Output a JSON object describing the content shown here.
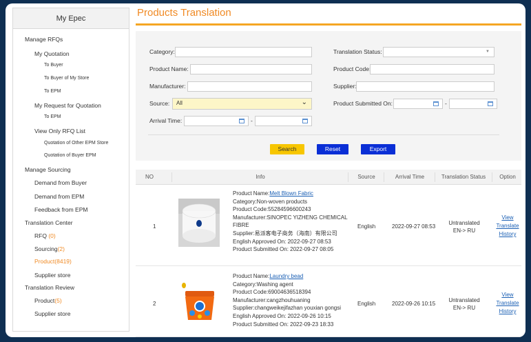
{
  "sidebar": {
    "title": "My Epec",
    "items": [
      {
        "label": "Manage RFQs",
        "level": 0,
        "count": ""
      },
      {
        "label": "My Quotation",
        "level": 1,
        "count": ""
      },
      {
        "label": "To Buyer",
        "level": 2,
        "count": ""
      },
      {
        "label": "To Buyer of My Store",
        "level": 2,
        "count": ""
      },
      {
        "label": "To EPM",
        "level": 2,
        "count": ""
      },
      {
        "label": "My Request for Quotation",
        "level": 1,
        "count": ""
      },
      {
        "label": "To EPM",
        "level": 2,
        "count": ""
      },
      {
        "label": "View Only RFQ List",
        "level": 1,
        "count": ""
      },
      {
        "label": "Quotation of Other EPM Store",
        "level": 2,
        "count": ""
      },
      {
        "label": "Quotation of Buyer EPM",
        "level": 2,
        "count": ""
      },
      {
        "label": "Manage Sourcing",
        "level": 0,
        "count": ""
      },
      {
        "label": "Demand from Buyer",
        "level": 1,
        "count": ""
      },
      {
        "label": "Demand from EPM",
        "level": 1,
        "count": ""
      },
      {
        "label": "Feedback from EPM",
        "level": 1,
        "count": ""
      },
      {
        "label": "Translation Center",
        "level": 0,
        "count": ""
      },
      {
        "label": "RFQ ",
        "level": 1,
        "count": "(0)"
      },
      {
        "label": "Sourcing",
        "level": 1,
        "count": "(2)"
      },
      {
        "label": "Product(8419)",
        "level": 1,
        "count": "",
        "active": true
      },
      {
        "label": "Supplier store",
        "level": 1,
        "count": ""
      },
      {
        "label": "Translation Review",
        "level": 0,
        "count": ""
      },
      {
        "label": "Product",
        "level": 1,
        "count": "(5)"
      },
      {
        "label": "Supplier store",
        "level": 1,
        "count": ""
      }
    ]
  },
  "page_title": "Products Translation",
  "filters": {
    "category_label": "Category:",
    "category_value": "",
    "translation_status_label": "Translation Status:",
    "translation_status_value": "",
    "product_name_label": "Product Name:",
    "product_name_value": "",
    "product_code_label": "Product Code:",
    "product_code_value": "",
    "manufacturer_label": "Manufacturer:",
    "manufacturer_value": "",
    "supplier_label": "Supplier:",
    "supplier_value": "",
    "source_label": "Source:",
    "source_value": "All",
    "submitted_label": "Product Submitted On:",
    "arrival_label": "Arrival Time:",
    "range_sep": "-"
  },
  "buttons": {
    "search": "Search",
    "reset": "Reset",
    "export": "Export"
  },
  "table": {
    "headers": [
      "NO",
      "Info",
      "Source",
      "Arrival Time",
      "Translation Status",
      "Option"
    ],
    "rows": [
      {
        "no": "1",
        "name_label": "Product Name:",
        "name": "Melt Blown Fabric",
        "category": "Category:Non-woven products",
        "code": "Product Code:55284596600243",
        "manufacturer_1": "Manufacturer:SINOPEC YIZHENG CHEMICAL",
        "manufacturer_2": "FIBRE",
        "supplier": "Supplier:易派客电子商务（海南）有限公司",
        "approved": "English Approved On: 2022-09-27 08:53",
        "submitted": "Product Submitted On: 2022-09-27 08:05",
        "source": "English",
        "arrival": "2022-09-27 08:53",
        "status_1": "Untranslated",
        "status_2": "EN-> RU",
        "opt_view": "View",
        "opt_translate": "Translate",
        "opt_history": "History"
      },
      {
        "no": "2",
        "name_label": "Product Name:",
        "name": "Laundry bead",
        "category": "Category:Washing agent",
        "code": "Product Code:69004636518394",
        "manufacturer_1": "Manufacturer:cangzhouhuaning",
        "manufacturer_2": "",
        "supplier": "Supplier:changweikejifazhan youxian gongsi",
        "approved": "English Approved On: 2022-09-26 10:15",
        "submitted": "Product Submitted On: 2022-09-23 18:33",
        "source": "English",
        "arrival": "2022-09-26 10:15",
        "status_1": "Untranslated",
        "status_2": "EN-> RU",
        "opt_view": "View",
        "opt_translate": "Translate",
        "opt_history": "History"
      }
    ]
  },
  "colors": {
    "accent": "#f08a24",
    "button_blue": "#0a2fd6",
    "button_yellow": "#f7c600",
    "background": "#0f2f52"
  }
}
